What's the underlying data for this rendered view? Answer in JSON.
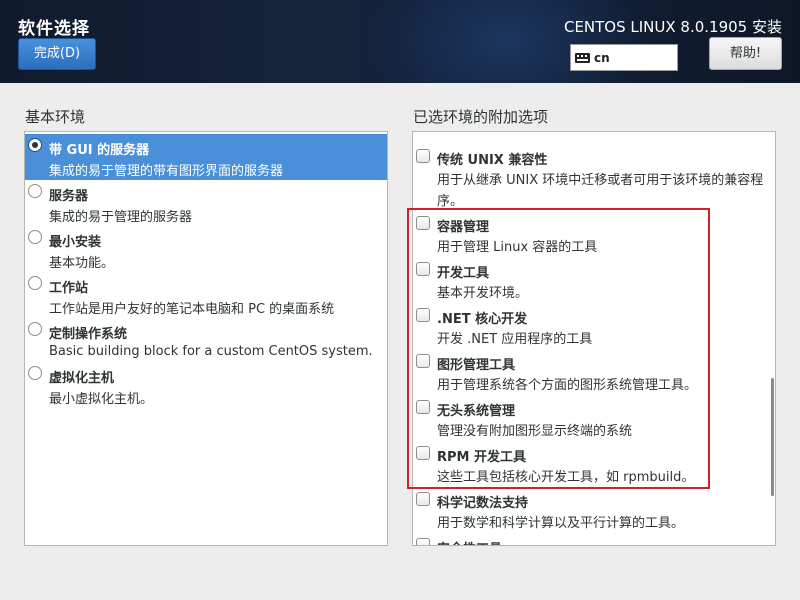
{
  "header": {
    "title": "软件选择",
    "done_label": "完成(D)",
    "product": "CENTOS LINUX 8.0.1905 安装",
    "keyboard_layout": "cn",
    "help_label": "帮助!"
  },
  "base_environment": {
    "label": "基本环境",
    "selected_index": 0,
    "items": [
      {
        "name": "带 GUI 的服务器",
        "desc": "集成的易于管理的带有图形界面的服务器"
      },
      {
        "name": "服务器",
        "desc": "集成的易于管理的服务器"
      },
      {
        "name": "最小安装",
        "desc": "基本功能。"
      },
      {
        "name": "工作站",
        "desc": "工作站是用户友好的笔记本电脑和 PC 的桌面系统"
      },
      {
        "name": "定制操作系统",
        "desc": "Basic building block for a custom CentOS system."
      },
      {
        "name": "虚拟化主机",
        "desc": "最小虚拟化主机。"
      }
    ]
  },
  "addons": {
    "label": "已选环境的附加选项",
    "items": [
      {
        "name": "传统 UNIX 兼容性",
        "desc": "用于从继承 UNIX 环境中迁移或者可用于该环境的兼容程序。",
        "checked": false
      },
      {
        "name": "容器管理",
        "desc": "用于管理 Linux 容器的工具",
        "checked": false
      },
      {
        "name": "开发工具",
        "desc": "基本开发环境。",
        "checked": false
      },
      {
        "name": ".NET 核心开发",
        "desc": "开发 .NET 应用程序的工具",
        "checked": false
      },
      {
        "name": "图形管理工具",
        "desc": "用于管理系统各个方面的图形系统管理工具。",
        "checked": false
      },
      {
        "name": "无头系统管理",
        "desc": "管理没有附加图形显示终端的系统",
        "checked": false
      },
      {
        "name": "RPM 开发工具",
        "desc": "这些工具包括核心开发工具，如 rpmbuild。",
        "checked": false
      },
      {
        "name": "科学记数法支持",
        "desc": "用于数学和科学计算以及平行计算的工具。",
        "checked": false
      },
      {
        "name": "安全性工具",
        "desc": "",
        "checked": false
      }
    ]
  },
  "colors": {
    "selection": "#4a90d9",
    "annotation_box": "#d0202a"
  }
}
